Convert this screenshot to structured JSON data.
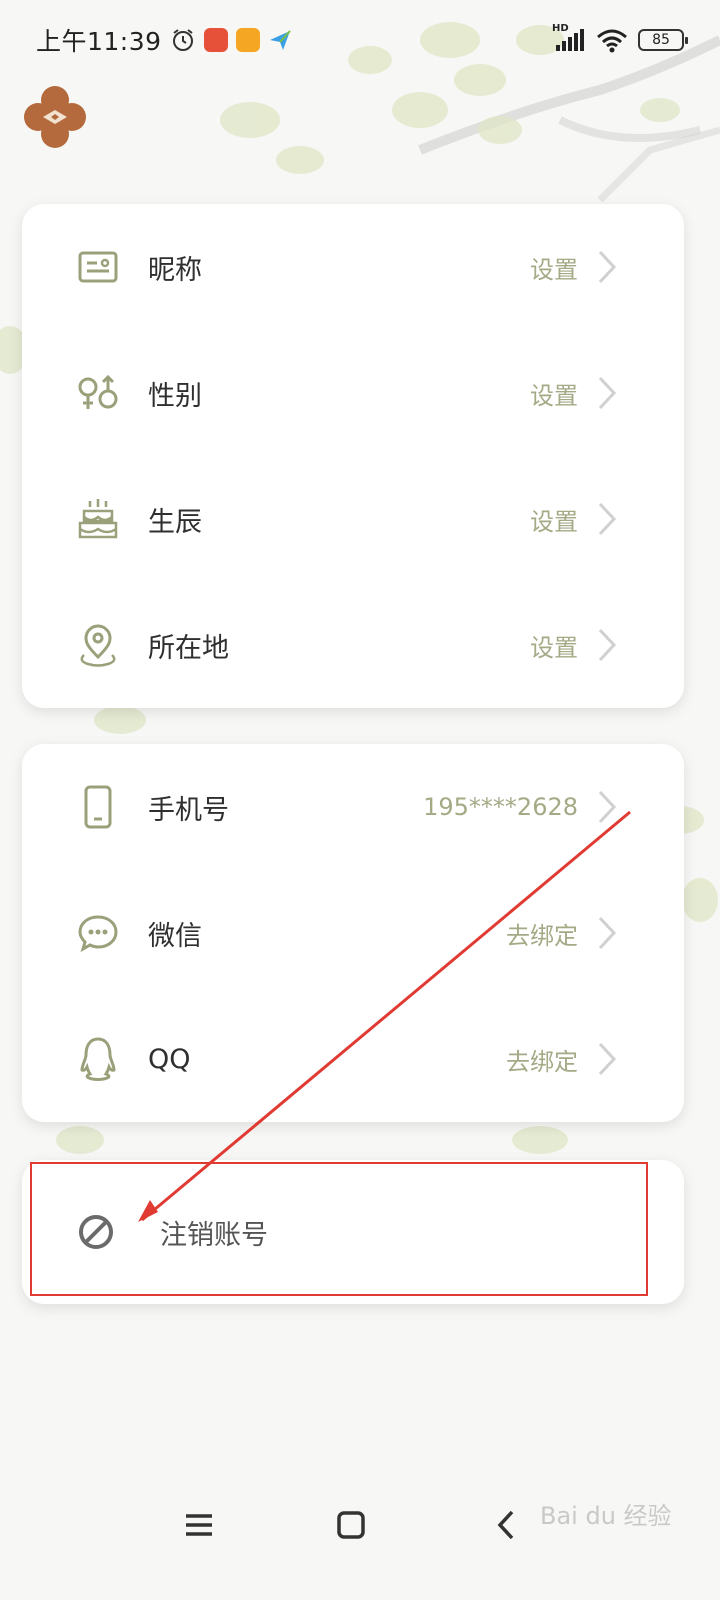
{
  "status_bar": {
    "time": "上午11:39",
    "hd_label": "HD",
    "battery": "85"
  },
  "profile_section": {
    "rows": [
      {
        "label": "昵称",
        "value": "设置",
        "icon": "id-card-icon"
      },
      {
        "label": "性别",
        "value": "设置",
        "icon": "gender-icon"
      },
      {
        "label": "生辰",
        "value": "设置",
        "icon": "birthday-cake-icon"
      },
      {
        "label": "所在地",
        "value": "设置",
        "icon": "location-pin-icon"
      }
    ]
  },
  "account_section": {
    "rows": [
      {
        "label": "手机号",
        "value": "195****2628",
        "icon": "phone-icon"
      },
      {
        "label": "微信",
        "value": "去绑定",
        "icon": "wechat-icon"
      },
      {
        "label": "QQ",
        "value": "去绑定",
        "icon": "qq-penguin-icon"
      }
    ]
  },
  "deactivate": {
    "label": "注销账号",
    "icon": "prohibited-icon"
  },
  "nav_bar": {
    "icons": [
      "menu-icon",
      "home-square-icon",
      "back-chevron-icon"
    ]
  },
  "watermark": "Bai du 经验",
  "colors": {
    "accent": "#a4aa86",
    "icon_green": "#9aa07a",
    "highlight_red": "#e03b33",
    "card_bg": "#ffffff"
  }
}
